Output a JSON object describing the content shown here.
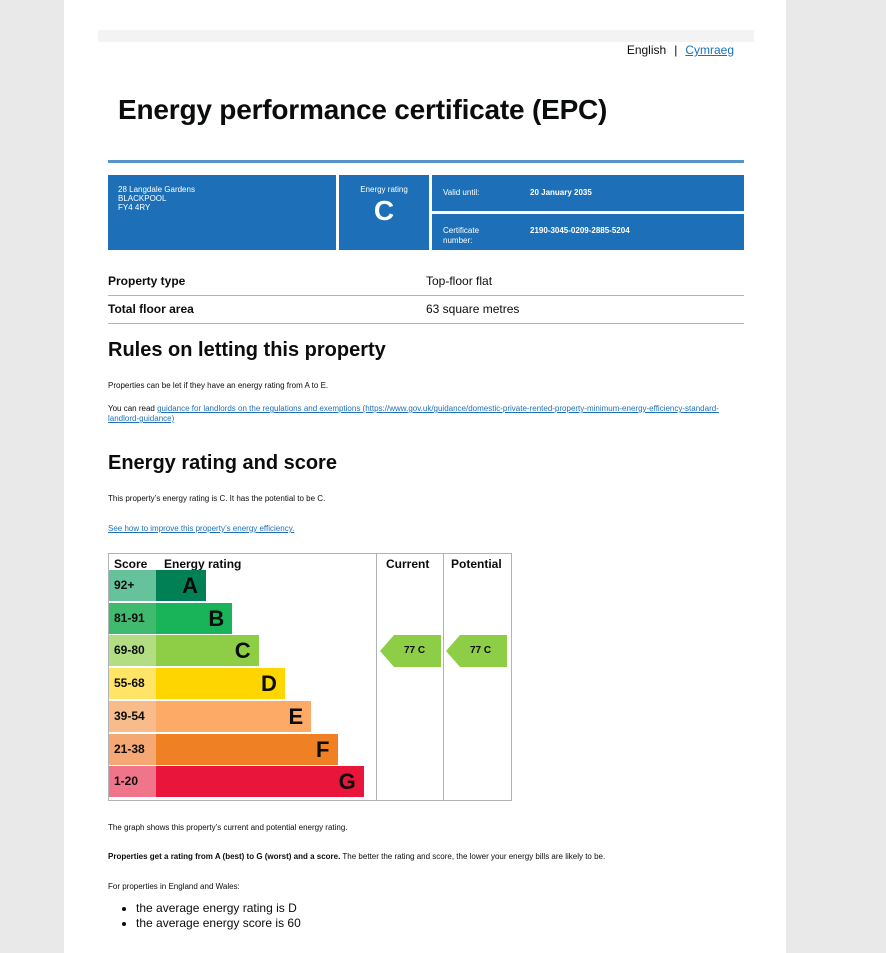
{
  "language": {
    "current": "English",
    "other": "Cymraeg"
  },
  "title": "Energy performance certificate (EPC)",
  "header": {
    "address_lines": [
      "28 Langdale Gardens",
      "BLACKPOOL",
      "FY4 4RY"
    ],
    "energy_rating_label": "Energy rating",
    "energy_rating_value": "C",
    "valid_until_label": "Valid until:",
    "valid_until_value": "20 January 2035",
    "certificate_label_1": "Certificate",
    "certificate_label_2": "number:",
    "certificate_value": "2190-3045-0209-2885-5204"
  },
  "property": [
    {
      "key": "Property type",
      "value": "Top-floor flat"
    },
    {
      "key": "Total floor area",
      "value": "63 square metres"
    }
  ],
  "rules": {
    "heading": "Rules on letting this property",
    "text1": "Properties can be let if they have an energy rating from A to E.",
    "text2_prefix": "You can read ",
    "text2_link": "guidance for landlords on the regulations and exemptions (https://www.gov.uk/guidance/domestic-private-rented-property-minimum-energy-efficiency-standard-landlord-guidance)"
  },
  "energy": {
    "heading": "Energy rating and score",
    "text1": "This property’s energy rating is C. It has the potential to be C.",
    "link": "See how to improve this property’s energy efficiency.",
    "table_headers": {
      "score": "Score",
      "rating": "Energy rating",
      "current": "Current",
      "potential": "Potential"
    },
    "bands": [
      {
        "score": "92+",
        "letter": "A",
        "color": "#008054",
        "score_bg": "#66c29a"
      },
      {
        "score": "81-91",
        "letter": "B",
        "color": "#19b459",
        "score_bg": "#3fba6e"
      },
      {
        "score": "69-80",
        "letter": "C",
        "color": "#8dce46",
        "score_bg": "#b3dd83"
      },
      {
        "score": "55-68",
        "letter": "D",
        "color": "#ffd500",
        "score_bg": "#ffe466"
      },
      {
        "score": "39-54",
        "letter": "E",
        "color": "#fcaa65",
        "score_bg": "#f7bb8c"
      },
      {
        "score": "21-38",
        "letter": "F",
        "color": "#ef8023",
        "score_bg": "#f5a873"
      },
      {
        "score": "1-20",
        "letter": "G",
        "color": "#e9153b",
        "score_bg": "#f0758b"
      }
    ],
    "current": {
      "score": "77",
      "letter": "C",
      "label": "77  C",
      "color": "#8dce46"
    },
    "potential": {
      "score": "77",
      "letter": "C",
      "label": "77  C",
      "color": "#8dce46"
    },
    "graph_caption": "The graph shows this property’s current and potential energy rating.",
    "rating_note_bold": "Properties get a rating from A (best) to G (worst) and a score.",
    "rating_note_rest": " The better the rating and score, the lower your energy bills are likely to be.",
    "england_wales": "For properties in England and Wales:",
    "averages": [
      "the average energy rating is D",
      "the average energy score is 60"
    ]
  }
}
